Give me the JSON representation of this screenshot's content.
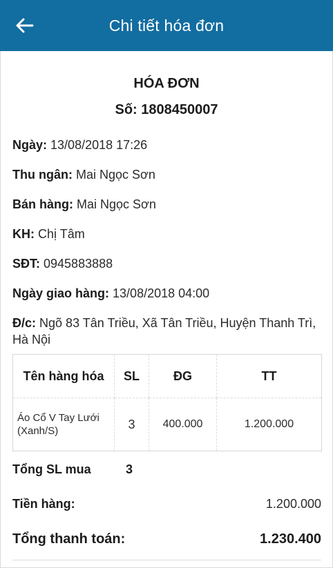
{
  "header": {
    "title": "Chi tiết hóa đơn",
    "back_icon": "arrow-left-icon"
  },
  "invoice": {
    "title": "HÓA ĐƠN",
    "number": "Số: 1808450007"
  },
  "fields": {
    "date": {
      "label": "Ngày:",
      "value": "13/08/2018 17:26"
    },
    "cashier": {
      "label": "Thu ngân:",
      "value": "Mai Ngọc Sơn"
    },
    "seller": {
      "label": "Bán hàng:",
      "value": "Mai Ngọc Sơn"
    },
    "customer": {
      "label": "KH:",
      "value": "Chị Tâm"
    },
    "phone": {
      "label": "SĐT:",
      "value": "0945883888"
    },
    "delivery": {
      "label": "Ngày giao hàng:",
      "value": "13/08/2018 04:00"
    },
    "address": {
      "label": "Đ/c:",
      "value": "Ngõ 83 Tân Triều, Xã Tân Triều, Huyện Thanh Trì, Hà Nội"
    }
  },
  "table": {
    "headers": [
      "Tên hàng hóa",
      "SL",
      "ĐG",
      "TT"
    ],
    "rows": [
      {
        "name": "Áo Cổ V Tay Lưới (Xanh/S)",
        "qty": "3",
        "price": "400.000",
        "total": "1.200.000"
      }
    ]
  },
  "summary": {
    "total_qty_label": "Tổng SL mua",
    "total_qty": "3",
    "subtotal_label": "Tiền hàng:",
    "subtotal": "1.200.000",
    "grand_total_label": "Tổng thanh toán:",
    "grand_total": "1.230.400"
  },
  "colors": {
    "appbar": "#126da0",
    "appbar_text": "#ffffff"
  }
}
